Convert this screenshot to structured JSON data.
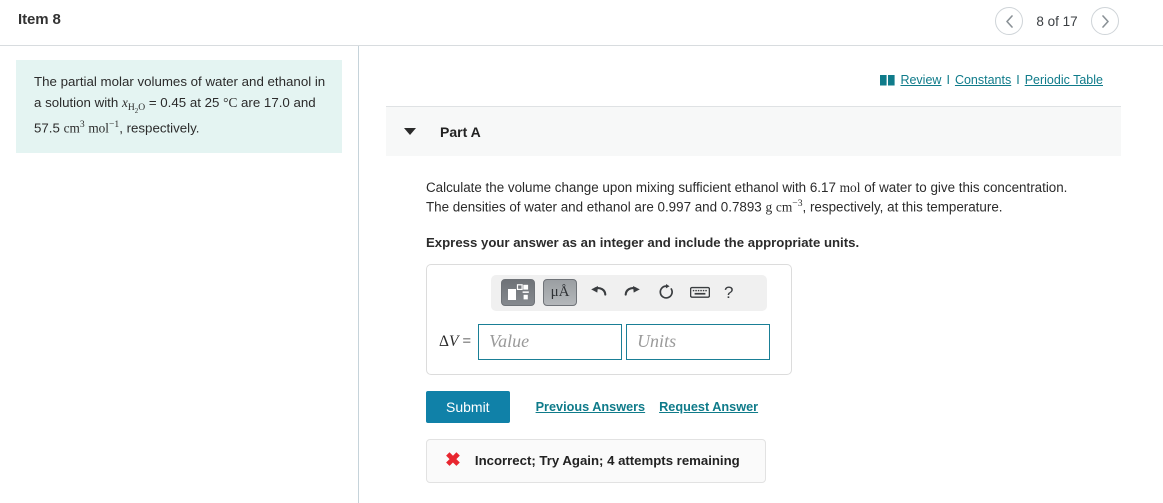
{
  "header": {
    "item_title": "Item 8",
    "pager": {
      "prev_icon": "chevron-left-icon",
      "label": "8 of 17",
      "next_icon": "chevron-right-icon"
    }
  },
  "resources": {
    "book_icon": "book-icon",
    "review": "Review",
    "separator": "I",
    "constants": "Constants",
    "periodic_table": "Periodic Table"
  },
  "statement": {
    "line1_a": "The partial molar volumes of water and ethanol in a solution with ",
    "var_x": "x",
    "var_x_sub": "H",
    "var_x_sub2": "2",
    "var_x_sub3": "O",
    "line1_b": " = 0.45 at 25 ",
    "degree": "°",
    "celsius": "C",
    "line1_c": " are 17.0 and",
    "line2_num": "57.5 ",
    "line2_unit_cm": "cm",
    "line2_unit_cm_exp": "3",
    "line2_unit_mol": "mol",
    "line2_unit_mol_exp": "−1",
    "line2_tail": ", respectively."
  },
  "part": {
    "caret_icon": "caret-down-icon",
    "label": "Part A",
    "question_a": "Calculate the volume change upon mixing sufficient ethanol with 6.17 ",
    "question_mol": "mol",
    "question_b": " of water to give this concentration. The densities of water and ethanol are 0.997 and 0.7893 ",
    "question_unit_g": "g",
    "question_unit_cm": "cm",
    "question_unit_exp": "−3",
    "question_c": ", respectively, at this temperature.",
    "instruction": "Express your answer as an integer and include the appropriate units."
  },
  "toolbar": {
    "template_button": "math-template-icon",
    "units_button": "μÅ",
    "undo_icon": "undo-arrow-icon",
    "redo_icon": "redo-arrow-icon",
    "reset_icon": "reset-circle-icon",
    "keyboard_icon": "keyboard-icon",
    "help_label": "?"
  },
  "answer": {
    "variable_delta": "Δ",
    "variable_name": "V",
    "equals": "=",
    "value_placeholder": "Value",
    "value_text": "",
    "units_placeholder": "Units",
    "units_text": ""
  },
  "actions": {
    "submit_label": "Submit",
    "previous_answers": "Previous Answers",
    "request_answer": "Request Answer"
  },
  "feedback": {
    "icon": "red-x-icon",
    "message": "Incorrect; Try Again; 4 attempts remaining"
  },
  "colors": {
    "accent_teal": "#1081a8",
    "link_teal": "#0f7b8a",
    "statement_bg": "#e4f4f2",
    "error_red": "#e8262f",
    "input_border": "#1a7f96"
  }
}
